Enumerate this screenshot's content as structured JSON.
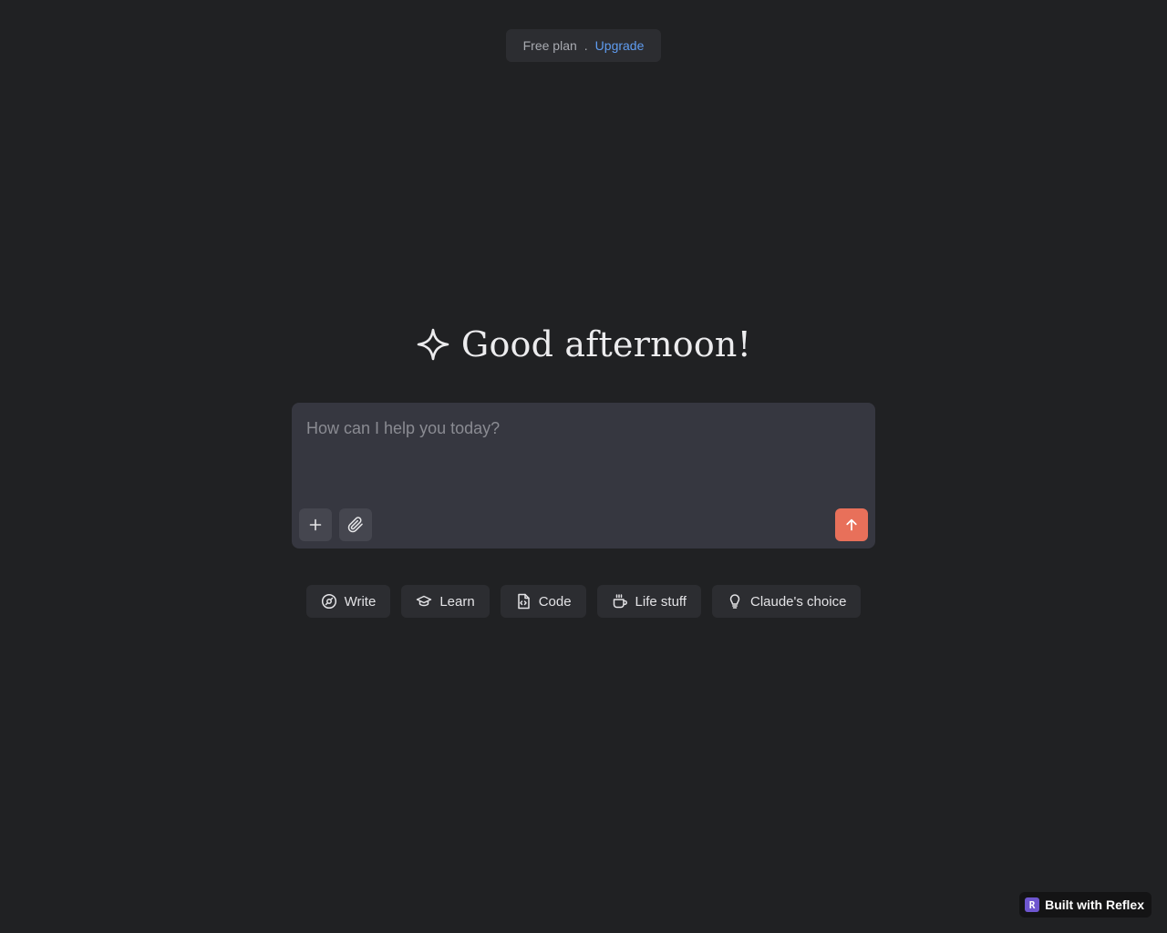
{
  "plan": {
    "label": "Free plan",
    "separator": ".",
    "upgrade_label": "Upgrade",
    "link_color": "#5f9cf0"
  },
  "greeting": {
    "icon": "sparkle-icon",
    "text": "Good afternoon!"
  },
  "composer": {
    "placeholder": "How can I help you today?",
    "value": "",
    "tools": [
      {
        "icon": "plus-icon"
      },
      {
        "icon": "paperclip-icon"
      }
    ],
    "send_icon": "arrow-up-icon",
    "send_color": "#e8705a"
  },
  "chips": [
    {
      "label": "Write",
      "icon": "pen-circle-icon"
    },
    {
      "label": "Learn",
      "icon": "graduation-cap-icon"
    },
    {
      "label": "Code",
      "icon": "code-file-icon"
    },
    {
      "label": "Life stuff",
      "icon": "coffee-cup-icon"
    },
    {
      "label": "Claude's choice",
      "icon": "lightbulb-icon"
    }
  ],
  "badge": {
    "logo": "R",
    "label": "Built with Reflex",
    "logo_color": "#6e56cf"
  }
}
